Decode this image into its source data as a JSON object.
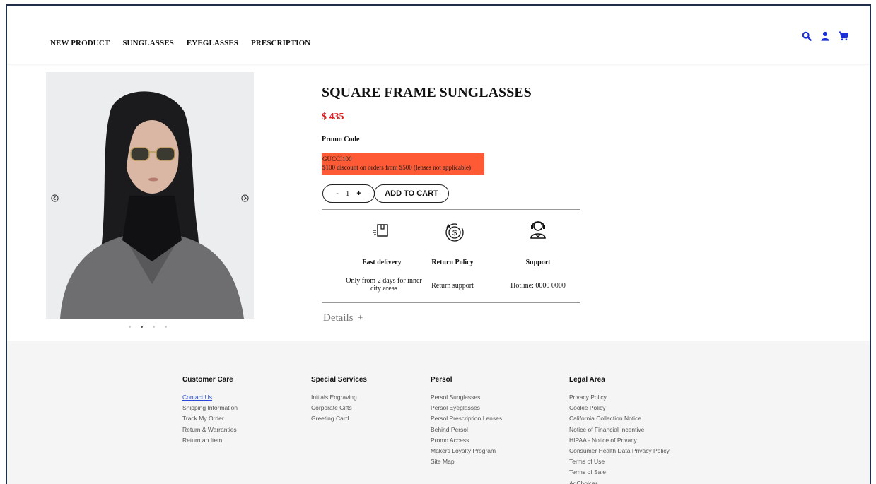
{
  "nav": {
    "items": [
      "NEW PRODUCT",
      "SUNGLASSES",
      "EYEGLASSES",
      "PRESCRIPTION"
    ]
  },
  "icons": {
    "accent_color": "#1a2fd6",
    "header": [
      "search-icon",
      "user-icon",
      "cart-icon"
    ]
  },
  "product": {
    "title": "SQUARE FRAME SUNGLASSES",
    "price": "$ 435",
    "price_color": "#e31b1b",
    "promo_label": "Promo Code",
    "promo_code": "GUCCI100",
    "promo_text": "$100 discount on orders from $500 (lenses not applicable)",
    "promo_bg": "#ff5a36",
    "quantity": "1",
    "minus": "-",
    "plus": "+",
    "add_to_cart": "ADD TO CART",
    "details": "Details",
    "details_toggle": "+"
  },
  "gallery": {
    "active_dot": 1,
    "dot_count": 4
  },
  "features": [
    {
      "icon": "delivery-box-icon",
      "title": "Fast delivery",
      "text": "Only from 2 days for inner city areas"
    },
    {
      "icon": "dollar-return-icon",
      "title": "Return Policy",
      "text": "Return support"
    },
    {
      "icon": "support-agent-icon",
      "title": "Support",
      "text": "Hotline: 0000 0000"
    }
  ],
  "footer": {
    "columns": [
      {
        "title": "Customer Care",
        "links": [
          "Contact Us",
          "Shipping Information",
          "Track My Order",
          "Return & Warranties",
          "Return an Item"
        ]
      },
      {
        "title": "Special Services",
        "links": [
          "Initials Engraving",
          "Corporate Gifts",
          "Greeting Card"
        ]
      },
      {
        "title": "Persol",
        "links": [
          "Persol Sunglasses",
          "Persol Eyeglasses",
          "Persol Prescription Lenses",
          "Behind Persol",
          "Promo Access",
          "Makers Loyalty Program",
          "Site Map"
        ]
      },
      {
        "title": "Legal Area",
        "links": [
          "Privacy Policy",
          "Cookie Policy",
          "California Collection Notice",
          "Notice of Financial Incentive",
          "HIPAA - Notice of Privacy",
          "Consumer Health Data Privacy Policy",
          "Terms of Use",
          "Terms of Sale",
          "AdChoices"
        ]
      }
    ]
  }
}
